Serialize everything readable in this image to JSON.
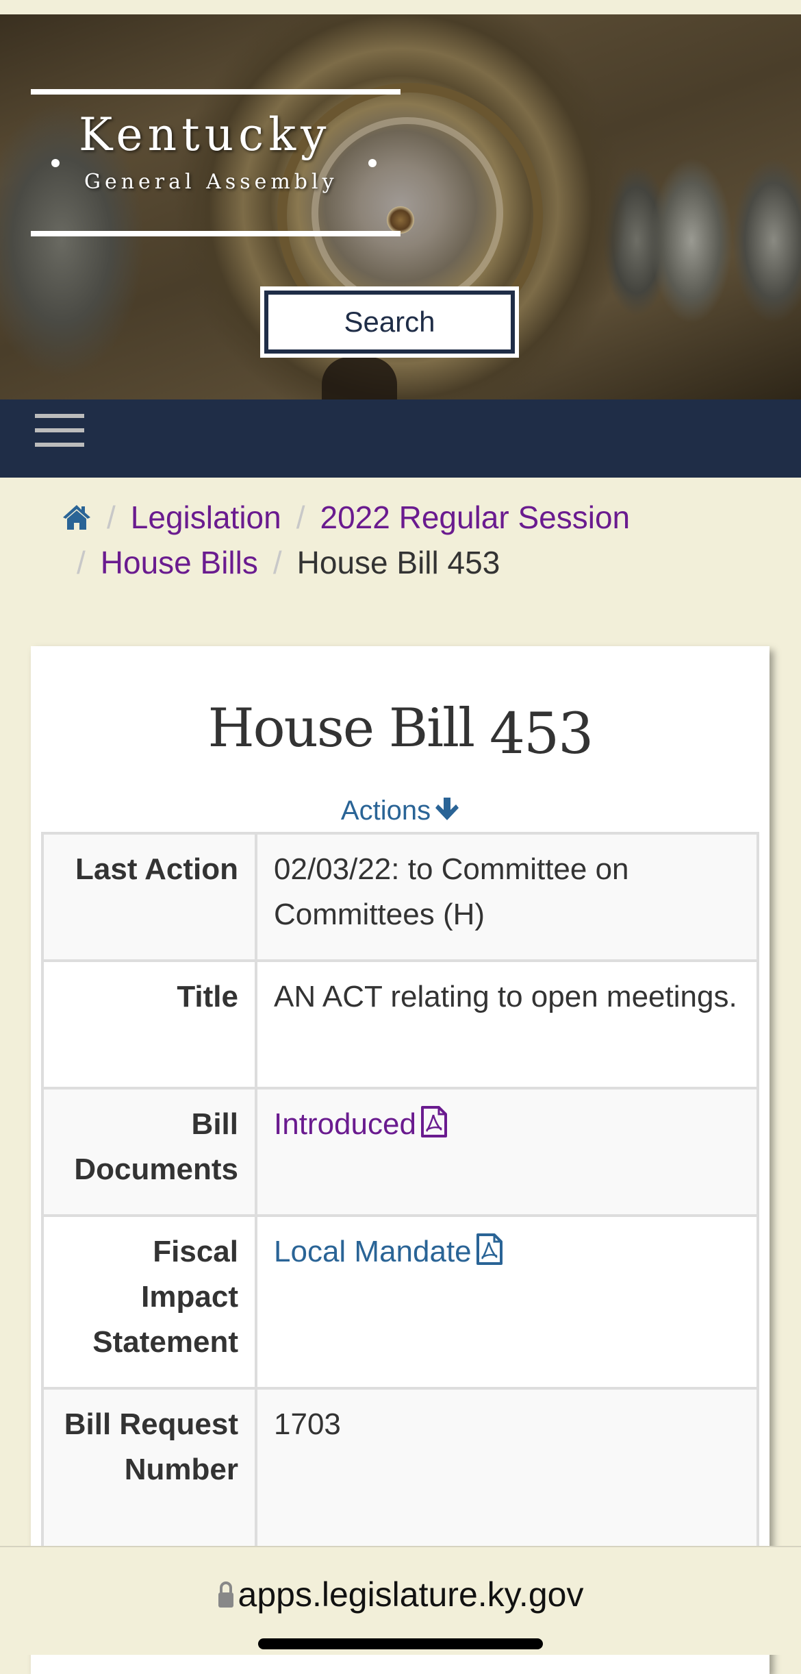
{
  "header": {
    "logo_title": "Kentucky",
    "logo_subtitle": "General Assembly",
    "search_label": "Search"
  },
  "nav": {
    "menu_icon": "hamburger-menu-icon"
  },
  "breadcrumb": {
    "home_icon": "home-icon",
    "items": [
      {
        "label": "Legislation",
        "link": true
      },
      {
        "label": "2022 Regular Session",
        "link": true
      },
      {
        "label": "House Bills",
        "link": true
      },
      {
        "label": "House Bill 453",
        "link": false
      }
    ],
    "separator": "/"
  },
  "bill": {
    "title_prefix": "House Bill",
    "title_number": "453",
    "actions_label": "Actions",
    "rows": [
      {
        "label": "Last Action",
        "value": "02/03/22: to Committee on Committees (H)"
      },
      {
        "label": "Title",
        "value": "AN ACT relating to open meetings."
      },
      {
        "label": "Bill Documents",
        "value": "Introduced",
        "icon": "pdf-icon"
      },
      {
        "label": "Fiscal Impact Statement",
        "value": "Local Mandate",
        "icon": "pdf-icon"
      },
      {
        "label": "Bill Request Number",
        "value": "1703"
      }
    ]
  },
  "browser": {
    "url": "apps.legislature.ky.gov"
  },
  "colors": {
    "navy": "#1f2d47",
    "visited_link": "#6a1b8f",
    "link": "#2a6496",
    "background": "#f2efd9"
  }
}
